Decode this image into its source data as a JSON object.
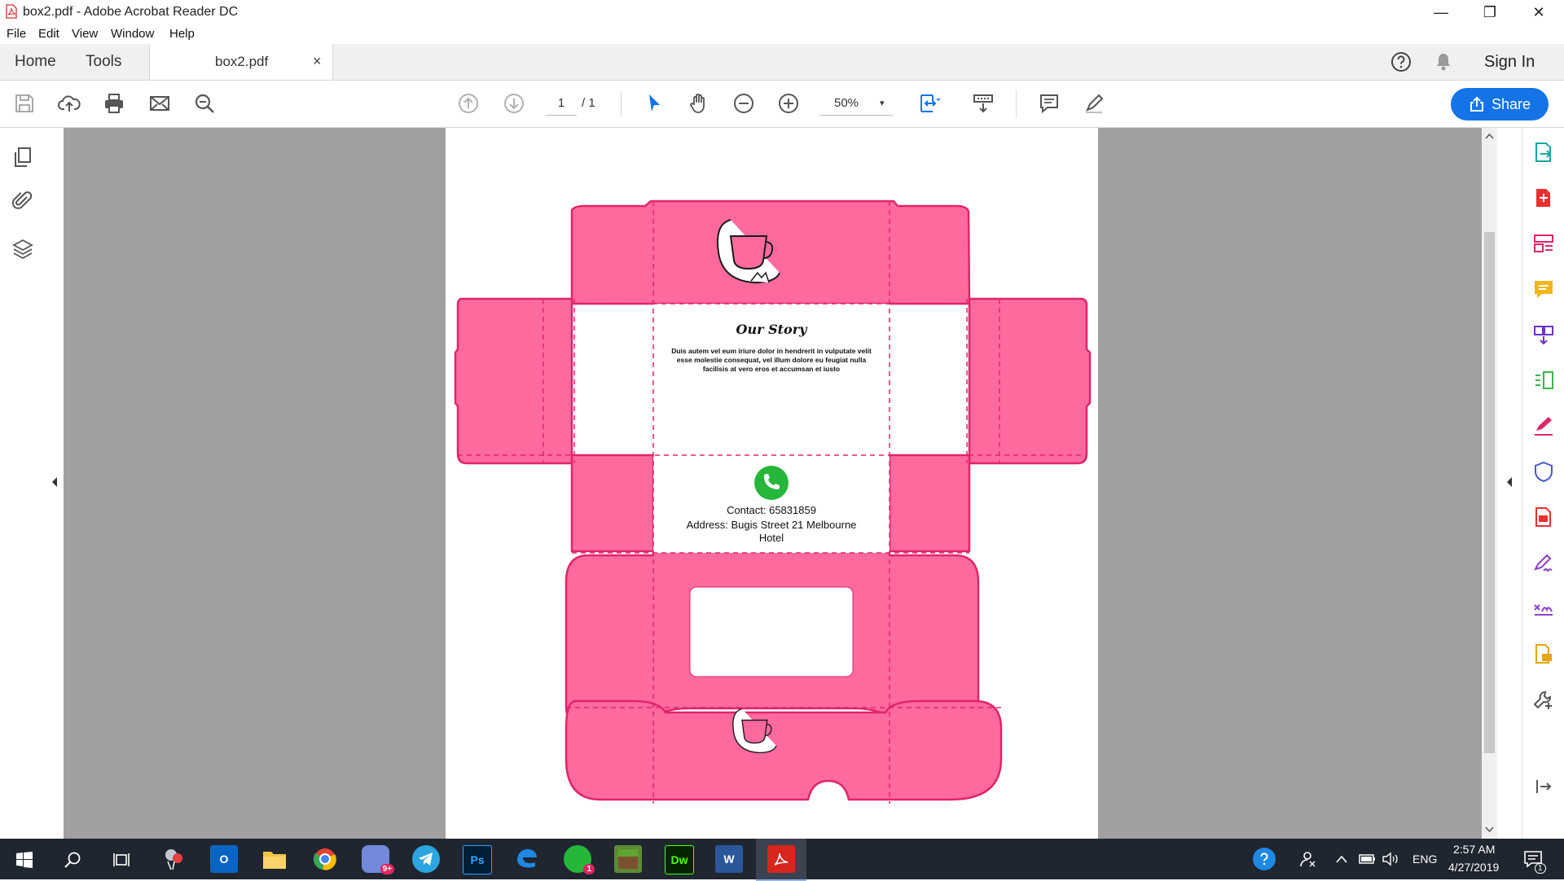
{
  "window": {
    "title": "box2.pdf - Adobe Acrobat Reader DC",
    "minimize": "—",
    "maximize": "❐",
    "close": "✕"
  },
  "menu": [
    "File",
    "Edit",
    "View",
    "Window",
    "Help"
  ],
  "tabs": {
    "home": "Home",
    "tools": "Tools",
    "document": "box2.pdf",
    "close": "×"
  },
  "header": {
    "help_icon": "help-circle-icon",
    "bell_icon": "bell-icon",
    "sign_in": "Sign In"
  },
  "toolbar": {
    "page_current": "1",
    "page_total": "/ 1",
    "zoom": "50%",
    "zoom_caret": "▾",
    "share": "Share",
    "accent": "#1473e6"
  },
  "document": {
    "story_title": "Our Story",
    "story_text": "Duis autem vel eum iriure dolor in hendrerit in vulputate velit esse molestie consequat, vel illum dolore eu feugiat nulla facilisis at vero eros et accumsan et iusto",
    "contact": "Contact: 65831859",
    "address": "Address: Bugis Street 21 Melbourne Hotel",
    "box_color": "#ff6a9e",
    "box_outline": "#e0256a",
    "whatsapp_color": "#25b63a"
  },
  "taskbar": {
    "time": "2:57 AM",
    "date": "4/27/2019",
    "language": "ENG",
    "discord_badge": "9+",
    "whatsapp_badge": "1",
    "notification_badge": "1",
    "photoshop": "Ps",
    "dreamweaver": "Dw",
    "word": "W"
  }
}
